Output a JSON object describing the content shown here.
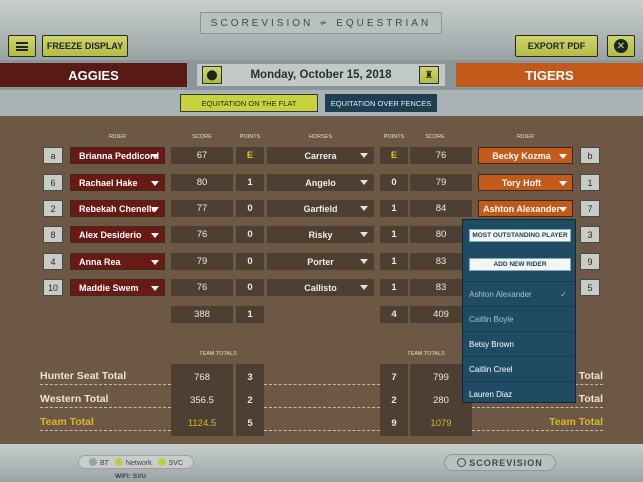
{
  "header": {
    "brand": "SCOREVISION ≁ EQUESTRIAN",
    "freeze_label": "FREEZE DISPLAY",
    "export_label": "EXPORT PDF",
    "date": "Monday, October 15, 2018"
  },
  "teams": {
    "home": "AGGIES",
    "away": "TIGERS",
    "home_color": "#5a1a14",
    "away_color": "#c45a1a"
  },
  "tabs": {
    "flat": "EQUITATION ON THE FLAT",
    "fences": "EQUITATION OVER FENCES"
  },
  "columns": {
    "rider": "RIDER",
    "score": "SCORE",
    "points": "POINTS",
    "horses": "HORSES",
    "points_r": "POINTS",
    "score_r": "SCORE",
    "rider_r": "RIDER"
  },
  "rows": [
    {
      "lbadge": "a",
      "lrider": "Brianna Peddicord",
      "lscore": "67",
      "lpts": "E",
      "horse": "Carrera",
      "rpts": "E",
      "rscore": "76",
      "rrider": "Becky Kozma",
      "rbadge": "b"
    },
    {
      "lbadge": "6",
      "lrider": "Rachael Hake",
      "lscore": "80",
      "lpts": "1",
      "horse": "Angelo",
      "rpts": "0",
      "rscore": "79",
      "rrider": "Tory Hoft",
      "rbadge": "1"
    },
    {
      "lbadge": "2",
      "lrider": "Rebekah Chenelle",
      "lscore": "77",
      "lpts": "0",
      "horse": "Garfield",
      "rpts": "1",
      "rscore": "84",
      "rrider": "Ashton Alexander",
      "rbadge": "7"
    },
    {
      "lbadge": "8",
      "lrider": "Alex Desiderio",
      "lscore": "76",
      "lpts": "0",
      "horse": "Risky",
      "rpts": "1",
      "rscore": "80",
      "rrider": "",
      "rbadge": "3"
    },
    {
      "lbadge": "4",
      "lrider": "Anna Rea",
      "lscore": "79",
      "lpts": "0",
      "horse": "Porter",
      "rpts": "1",
      "rscore": "83",
      "rrider": "",
      "rbadge": "9"
    },
    {
      "lbadge": "10",
      "lrider": "Maddie Swem",
      "lscore": "76",
      "lpts": "0",
      "horse": "Callisto",
      "rpts": "1",
      "rscore": "83",
      "rrider": "",
      "rbadge": "5"
    }
  ],
  "subtotal": {
    "lscore": "388",
    "lpts": "1",
    "rpts": "4",
    "rscore": "409"
  },
  "team_totals_label": "TEAM TOTALS",
  "totals": [
    {
      "label": "Hunter Seat Total",
      "lscore": "768",
      "lpts": "3",
      "rpts": "7",
      "rscore": "799",
      "rlabel": "Total"
    },
    {
      "label": "Western Total",
      "lscore": "356.5",
      "lpts": "2",
      "rpts": "2",
      "rscore": "280",
      "rlabel": "Western Total"
    },
    {
      "label": "Team Total",
      "lscore": "1124.5",
      "lpts": "5",
      "rpts": "9",
      "rscore": "1079",
      "rlabel": "Team Total"
    }
  ],
  "dropdown": {
    "most_outstanding": "MOST OUTSTANDING PLAYER",
    "add_rider": "ADD NEW RIDER",
    "items": [
      "Ashton Alexander",
      "Caitlin Boyle",
      "Betsy Brown",
      "Caitlin Creel",
      "Lauren Diaz"
    ]
  },
  "footer": {
    "bt": "BT",
    "network": "Network",
    "svc": "SVC",
    "wifi": "WIFI: SVU",
    "logo": "SCOREVISION"
  }
}
